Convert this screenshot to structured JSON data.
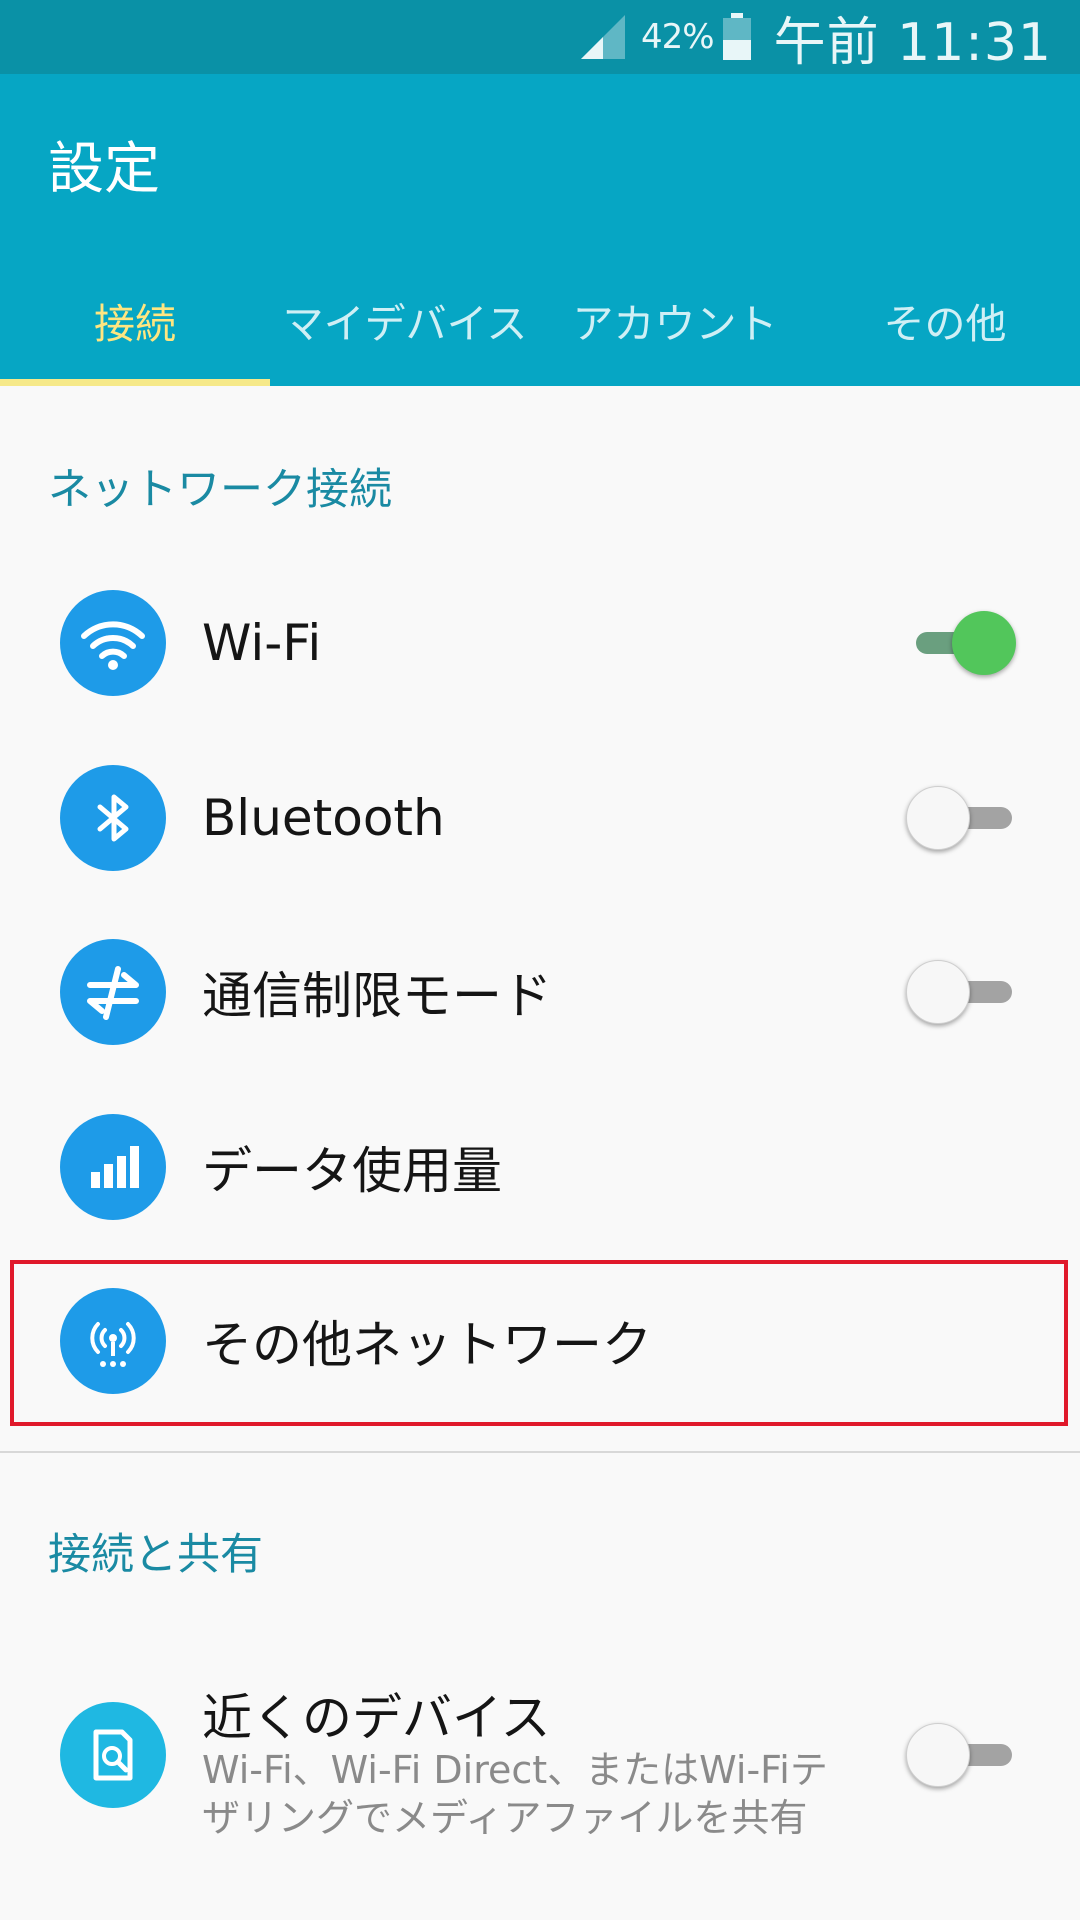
{
  "status_bar": {
    "battery_percent": "42%",
    "time": "午前 11:31"
  },
  "app_bar": {
    "title": "設定",
    "tabs": [
      {
        "label": "接続",
        "active": true
      },
      {
        "label": "マイデバイス",
        "active": false
      },
      {
        "label": "アカウント",
        "active": false
      },
      {
        "label": "その他",
        "active": false
      }
    ]
  },
  "sections": [
    {
      "header": "ネットワーク接続",
      "items": [
        {
          "label": "Wi-Fi",
          "icon": "wifi-icon",
          "toggle": "on"
        },
        {
          "label": "Bluetooth",
          "icon": "bluetooth-icon",
          "toggle": "off"
        },
        {
          "label": "通信制限モード",
          "icon": "airplane-mode-icon",
          "toggle": "off"
        },
        {
          "label": "データ使用量",
          "icon": "data-usage-icon"
        },
        {
          "label": "その他ネットワーク",
          "icon": "antenna-icon",
          "highlighted": true
        }
      ]
    },
    {
      "header": "接続と共有",
      "items": [
        {
          "label": "近くのデバイス",
          "icon": "nearby-devices-icon",
          "toggle": "off",
          "subtitle": "Wi-Fi、Wi-Fi Direct、またはWi-Fiテザリングでメディアファイルを共有"
        }
      ]
    }
  ],
  "colors": {
    "status_bar": "#0a91a6",
    "app_bar": "#06a6c4",
    "active_tab": "#ffe680",
    "icon_bg": "#1e9be8",
    "toggle_on": "#52c65b",
    "highlight": "#e0192b",
    "section_header": "#1a8aa3"
  }
}
